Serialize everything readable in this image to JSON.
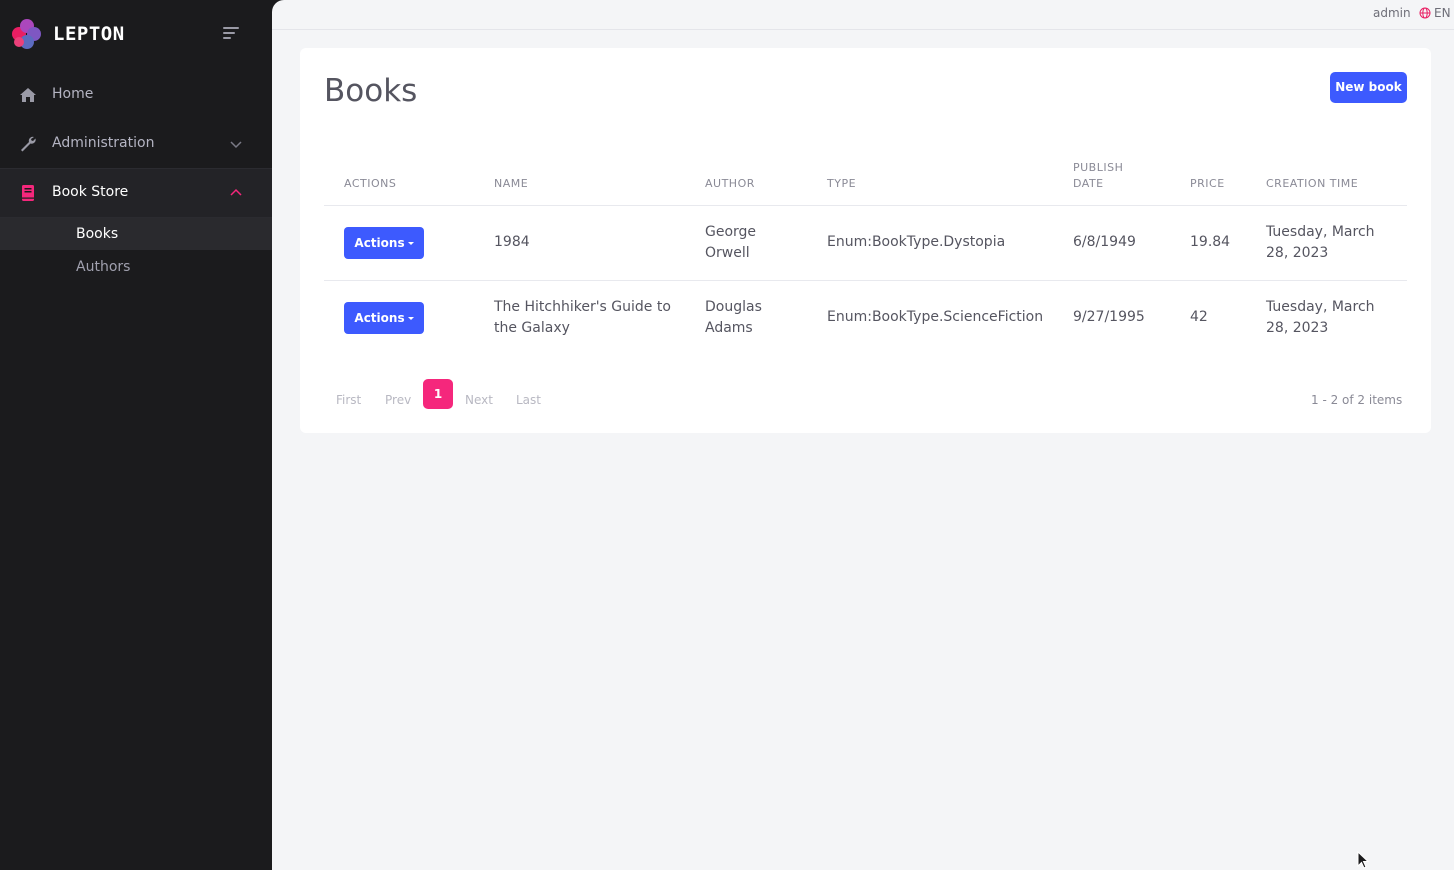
{
  "brand": {
    "name": "LEPTON"
  },
  "sidebar": {
    "items": [
      {
        "label": "Home",
        "icon": "home-icon"
      },
      {
        "label": "Administration",
        "icon": "wrench-icon"
      },
      {
        "label": "Book Store",
        "icon": "book-icon"
      }
    ],
    "sub_items": [
      {
        "label": "Books"
      },
      {
        "label": "Authors"
      }
    ]
  },
  "topbar": {
    "user": "admin",
    "language": "EN"
  },
  "page": {
    "title": "Books",
    "new_button": "New book"
  },
  "table": {
    "headers": {
      "actions": "ACTIONS",
      "name": "NAME",
      "author": "AUTHOR",
      "type": "TYPE",
      "publish_date_1": "PUBLISH",
      "publish_date_2": "DATE",
      "price": "PRICE",
      "creation_time": "CREATION TIME"
    },
    "action_label": "Actions",
    "rows": [
      {
        "name_1": "1984",
        "name_2": "",
        "author_1": "George",
        "author_2": "Orwell",
        "type": "Enum:BookType.Dystopia",
        "publish_date": "6/8/1949",
        "price": "19.84",
        "creation_1": "Tuesday, March",
        "creation_2": "28, 2023"
      },
      {
        "name_1": "The Hitchhiker's Guide to",
        "name_2": "the Galaxy",
        "author_1": "Douglas",
        "author_2": "Adams",
        "type": "Enum:BookType.ScienceFiction",
        "publish_date": "9/27/1995",
        "price": "42",
        "creation_1": "Tuesday, March",
        "creation_2": "28, 2023"
      }
    ]
  },
  "pagination": {
    "first": "First",
    "prev": "Prev",
    "current": "1",
    "next": "Next",
    "last": "Last",
    "info": "1 - 2 of 2 items"
  },
  "colors": {
    "accent": "#3d5afe",
    "brand_pink": "#f5277c",
    "sidebar_bg": "#1b1b1d"
  }
}
